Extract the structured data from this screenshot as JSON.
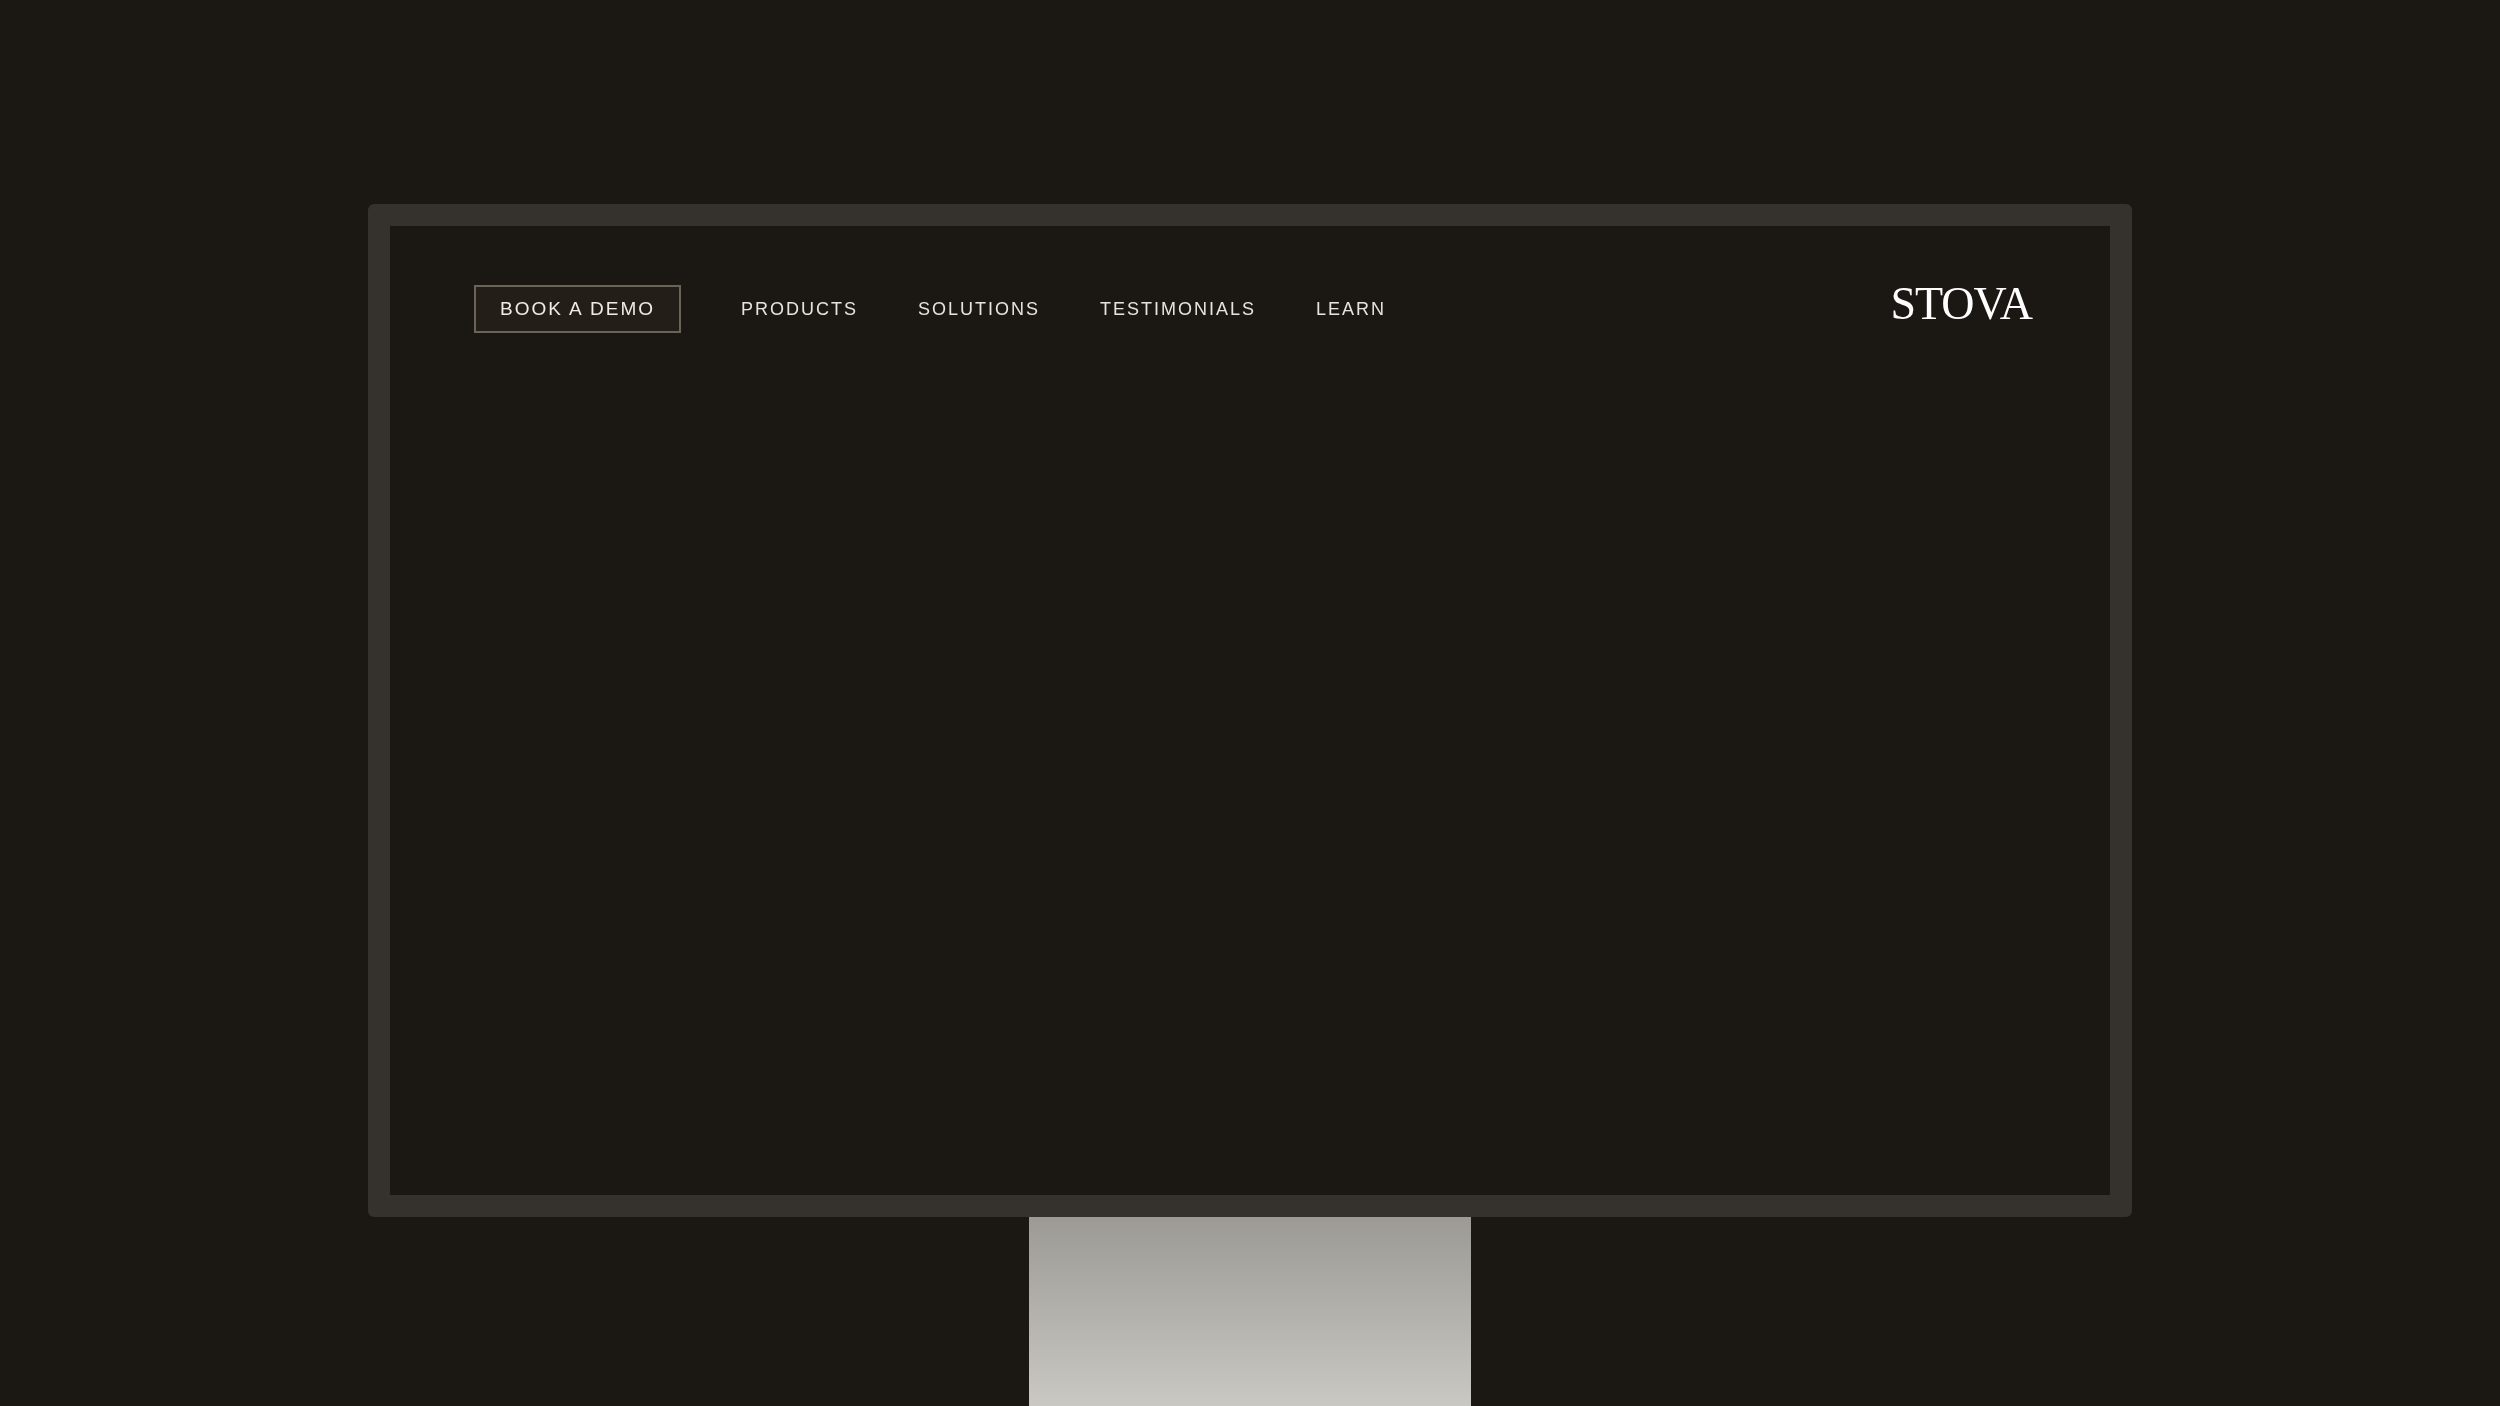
{
  "nav": {
    "cta": "BOOK A DEMO",
    "links": [
      "PRODUCTS",
      "SOLUTIONS",
      "TESTIMONIALS",
      "LEARN"
    ]
  },
  "logo": "STOVA"
}
